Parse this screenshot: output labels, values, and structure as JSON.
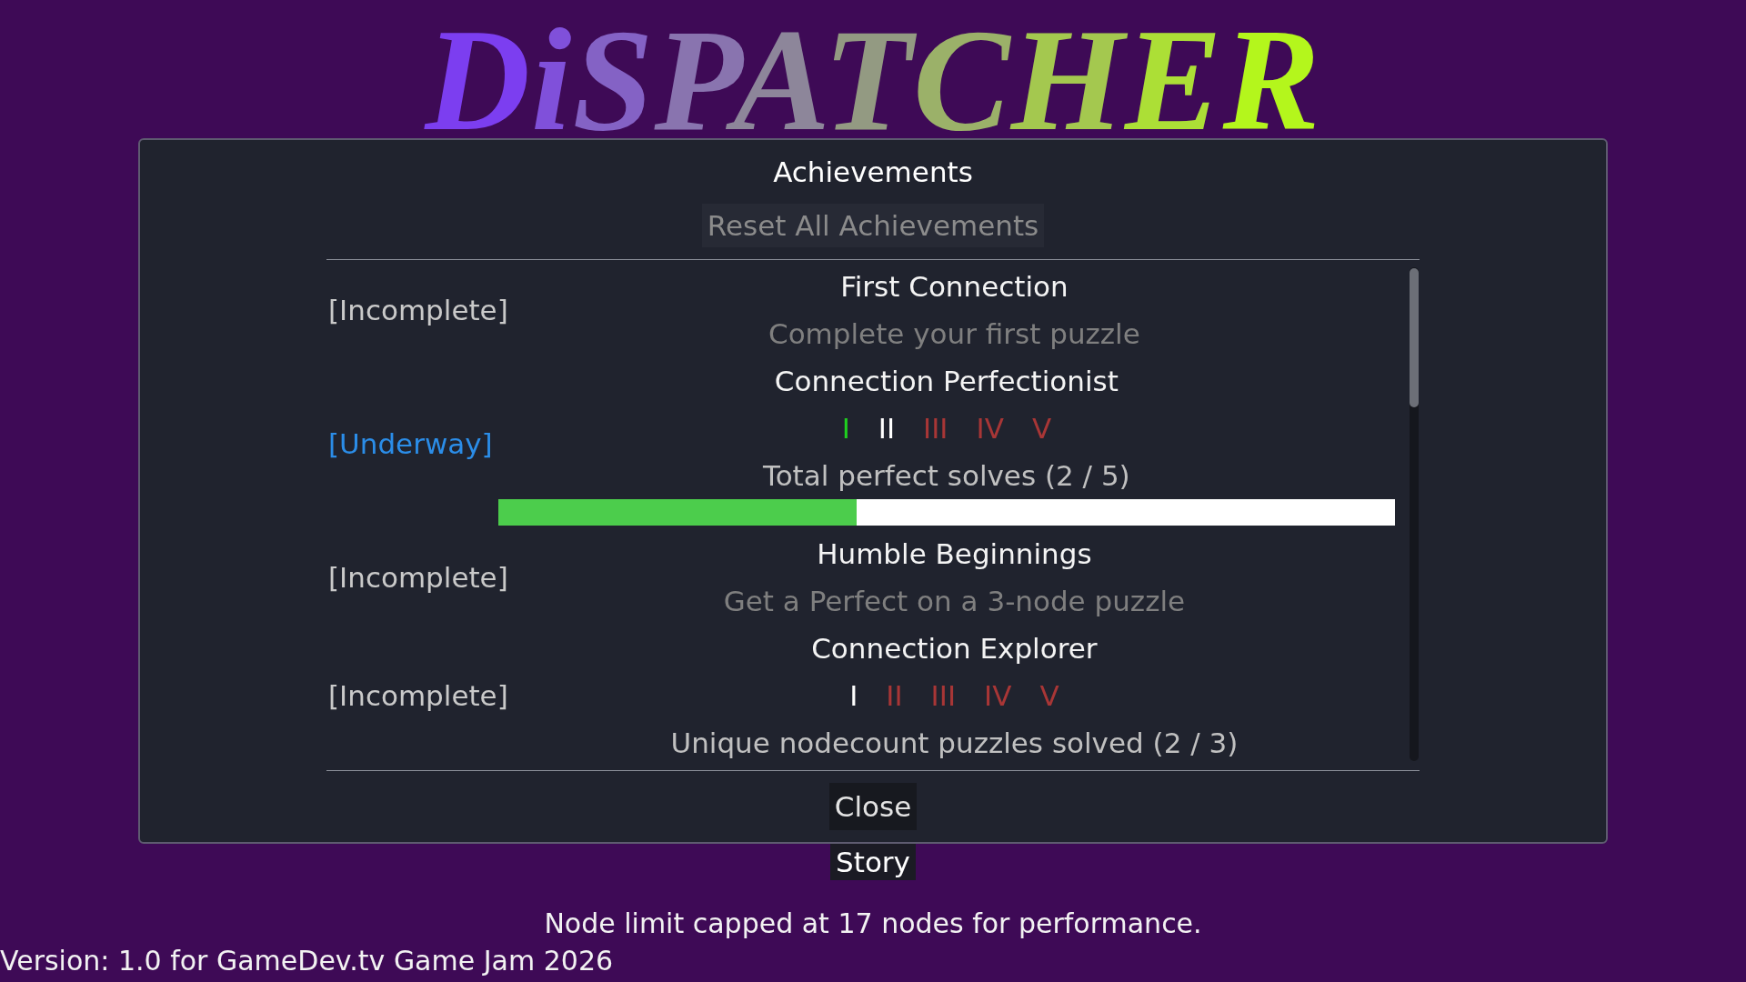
{
  "logo": "DiSPATCHER",
  "dialog": {
    "title": "Achievements",
    "reset_button": {
      "label": "Reset All Achievements",
      "disabled": true
    },
    "achievements": [
      {
        "kind": "single",
        "status": "[Incomplete]",
        "underway": false,
        "title": "First Connection",
        "description": "Complete your first puzzle"
      },
      {
        "kind": "tiered",
        "status": "[Underway]",
        "underway": true,
        "title": "Connection Perfectionist",
        "tiers": [
          {
            "label": "I",
            "achieved": true,
            "current": false
          },
          {
            "label": "II",
            "achieved": false,
            "current": true
          },
          {
            "label": "III",
            "achieved": false,
            "current": false
          },
          {
            "label": "IV",
            "achieved": false,
            "current": false
          },
          {
            "label": "V",
            "achieved": false,
            "current": false
          }
        ],
        "description": "Total perfect solves (2 / 5)",
        "level": 0.4
      },
      {
        "kind": "single",
        "status": "[Incomplete]",
        "underway": false,
        "title": "Humble Beginnings",
        "description": "Get a Perfect on a 3-node puzzle"
      },
      {
        "kind": "tiered",
        "status": "[Incomplete]",
        "underway": false,
        "title": "Connection Explorer",
        "tiers": [
          {
            "label": "I",
            "achieved": false,
            "current": true
          },
          {
            "label": "II",
            "achieved": false,
            "current": false
          },
          {
            "label": "III",
            "achieved": false,
            "current": false
          },
          {
            "label": "IV",
            "achieved": false,
            "current": false
          },
          {
            "label": "V",
            "achieved": false,
            "current": false
          }
        ],
        "description": "Unique nodecount puzzles solved (2 / 3)"
      }
    ],
    "close_button": "Close"
  },
  "menu": {
    "story_button": "Story"
  },
  "notice": "Node limit capped at 17 nodes for performance.",
  "version": "Version: 1.0 for GameDev.tv Game Jam 2026"
}
